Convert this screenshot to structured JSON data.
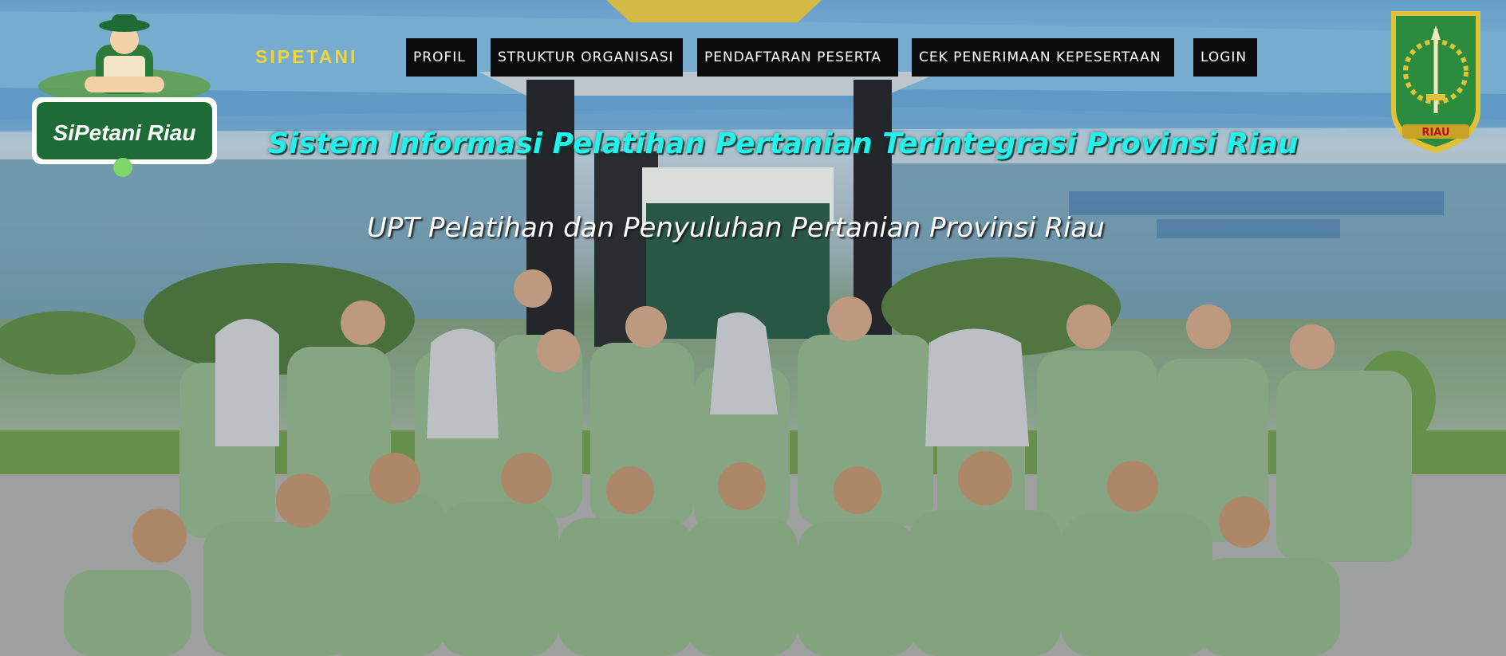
{
  "header": {
    "site_name": "SIPETANI",
    "logo_text": "SiPetani Riau",
    "emblem_text": "RIAU"
  },
  "nav": {
    "items": [
      {
        "label": "PROFIL"
      },
      {
        "label": "STRUKTUR ORGANISASI"
      },
      {
        "label": "PENDAFTARAN PESERTA"
      },
      {
        "label": "CEK PENERIMAAN KEPESERTAAN"
      },
      {
        "label": "LOGIN"
      }
    ]
  },
  "hero": {
    "title": "Sistem Informasi Pelatihan Pertanian Terintegrasi Provinsi Riau",
    "subtitle": "UPT Pelatihan dan Penyuluhan Pertanian Provinsi Riau"
  },
  "colors": {
    "site_name": "#f5d534",
    "title": "#22f2ea",
    "nav_bg": "#0b0b0b",
    "nav_text": "#ffffff",
    "logo_green": "#1d6b35",
    "shirt_green": "#8fb08b"
  }
}
